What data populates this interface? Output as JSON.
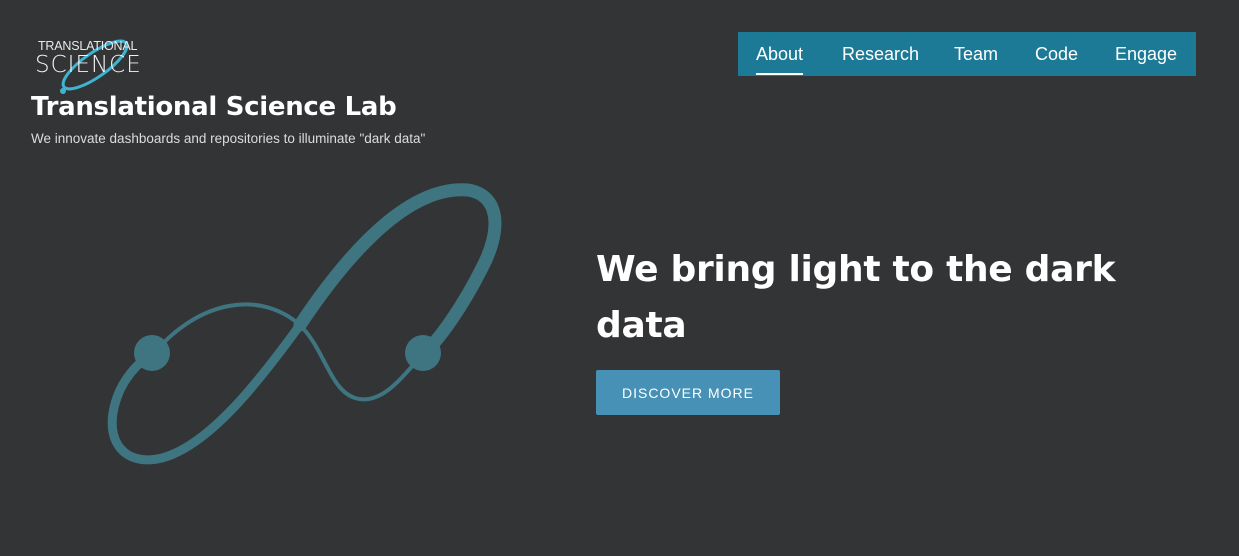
{
  "logo": {
    "line1": "TRANSLATIONAL",
    "line2": "SCIENCE"
  },
  "site": {
    "title": "Translational Science Lab",
    "tagline": "We innovate dashboards and repositories to illuminate \"dark data\""
  },
  "nav": {
    "items": [
      {
        "label": "About",
        "active": true
      },
      {
        "label": "Research",
        "active": false
      },
      {
        "label": "Team",
        "active": false
      },
      {
        "label": "Code",
        "active": false
      },
      {
        "label": "Engage",
        "active": false
      }
    ]
  },
  "hero": {
    "heading": "We bring light to the dark data",
    "button_label": "DISCOVER MORE",
    "graphic_icon": "orbit-infinity-icon"
  },
  "colors": {
    "background": "#333436",
    "nav_bg": "#1d7a97",
    "button_bg": "#4791b6",
    "graphic": "#3e7581",
    "logo_accent": "#3fb4d0"
  }
}
